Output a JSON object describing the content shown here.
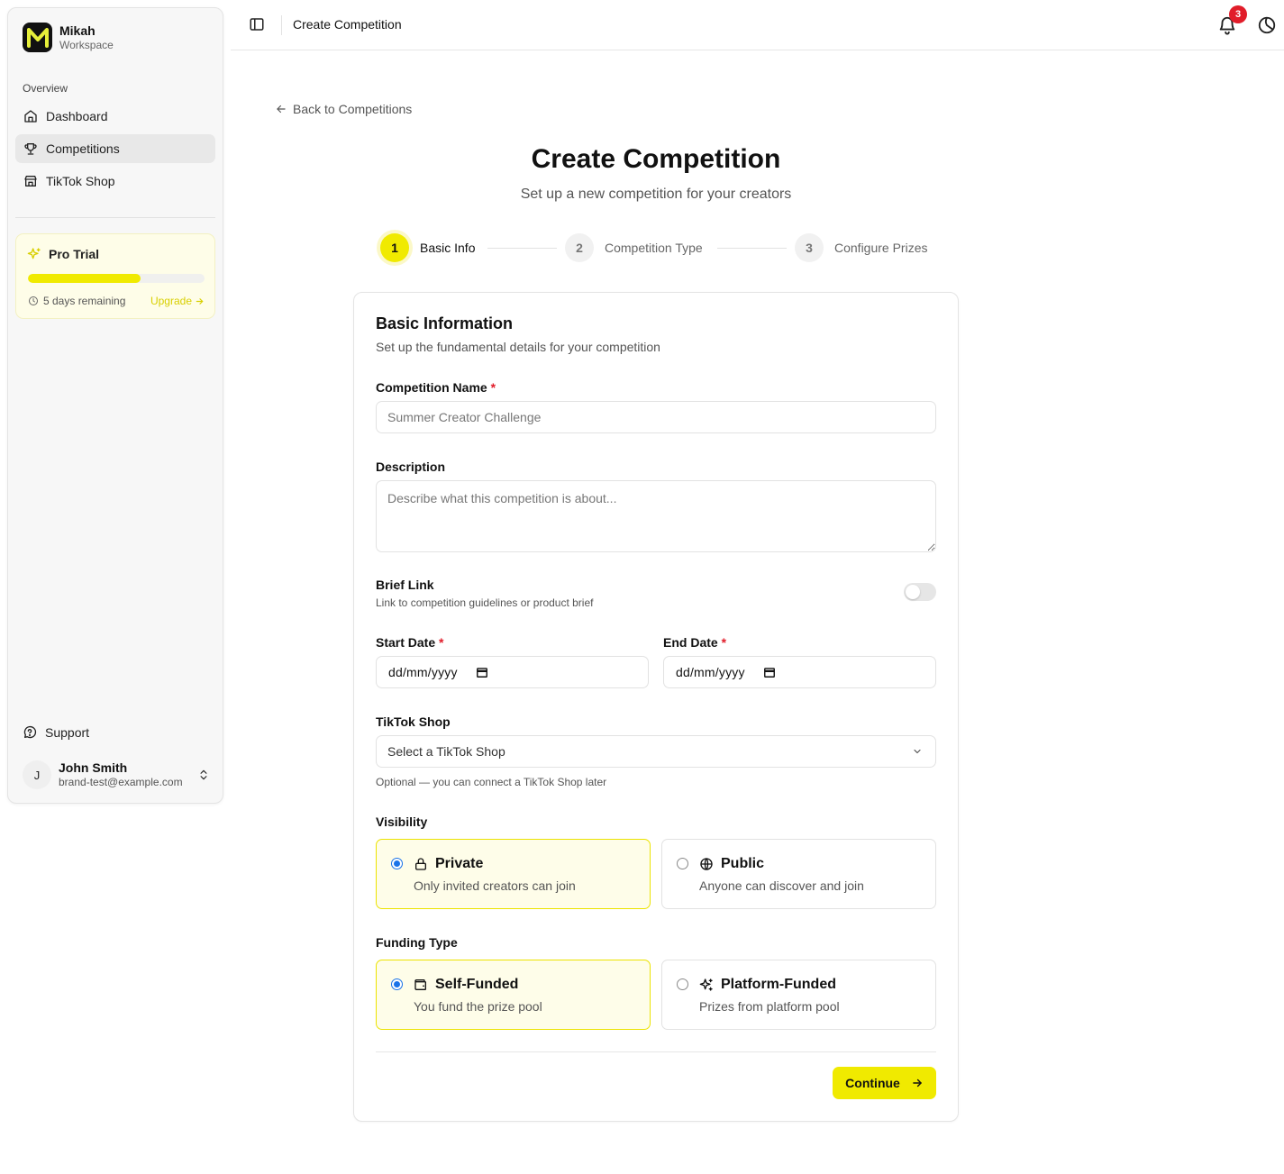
{
  "app": {
    "brand_name": "Mikah",
    "brand_sub": "Workspace"
  },
  "sidebar": {
    "group_label": "Overview",
    "items": [
      {
        "label": "Dashboard",
        "icon": "home-icon",
        "active": false
      },
      {
        "label": "Competitions",
        "icon": "trophy-icon",
        "active": true
      },
      {
        "label": "TikTok Shop",
        "icon": "store-icon",
        "active": false
      }
    ],
    "trial": {
      "title": "Pro Trial",
      "progress": 0.64,
      "remaining": "5 days remaining",
      "upgrade": "Upgrade"
    },
    "support": "Support",
    "user": {
      "initial": "J",
      "name": "John Smith",
      "email": "brand-test@example.com"
    }
  },
  "topbar": {
    "title": "Create Competition",
    "notification_count": "3"
  },
  "page": {
    "back": "Back to Competitions",
    "title": "Create Competition",
    "subtitle": "Set up a new competition for your creators"
  },
  "steps": [
    {
      "number": "1",
      "label": "Basic Info",
      "active": true
    },
    {
      "number": "2",
      "label": "Competition Type",
      "active": false
    },
    {
      "number": "3",
      "label": "Configure Prizes",
      "active": false
    }
  ],
  "form": {
    "title": "Basic Information",
    "subtitle": "Set up the fundamental details for your competition",
    "name_label": "Competition Name",
    "name_placeholder": "Summer Creator Challenge",
    "name_value": "",
    "required_mark": "*",
    "description_label": "Description",
    "description_placeholder": "Describe what this competition is about...",
    "description_value": "",
    "brief_label": "Brief Link",
    "brief_hint": "Link to competition guidelines or product brief",
    "brief_enabled": false,
    "start_label": "Start Date",
    "end_label": "End Date",
    "date_format": "dd/mm/yyyy",
    "shop_label": "TikTok Shop",
    "shop_value": "Select a TikTok Shop",
    "shop_hint": "Optional — you can connect a TikTok Shop later",
    "visibility_label": "Visibility",
    "visibility_options": [
      {
        "title": "Private",
        "desc": "Only invited creators can join",
        "icon": "lock-icon",
        "selected": true
      },
      {
        "title": "Public",
        "desc": "Anyone can discover and join",
        "icon": "globe-icon",
        "selected": false
      }
    ],
    "funding_label": "Funding Type",
    "funding_options": [
      {
        "title": "Self-Funded",
        "desc": "You fund the prize pool",
        "icon": "wallet-icon",
        "selected": true
      },
      {
        "title": "Platform-Funded",
        "desc": "Prizes from platform pool",
        "icon": "sparkles-icon",
        "selected": false
      }
    ],
    "continue": "Continue"
  },
  "colors": {
    "accent": "#f0ea00",
    "accent_soft": "#fefde9",
    "badge": "#e11d2a",
    "radio": "#1a73e8"
  }
}
